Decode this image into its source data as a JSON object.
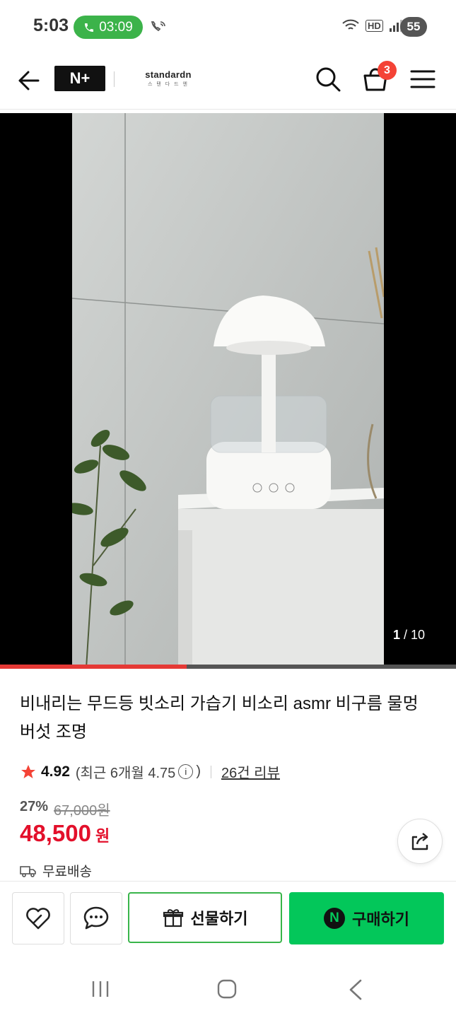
{
  "status_bar": {
    "time": "5:03",
    "call_timer": "03:09",
    "battery": "55",
    "hd_label": "HD"
  },
  "header": {
    "logo_text": "N+",
    "brand_name": "standardn",
    "brand_sub": "스 탠 다 드 엔",
    "cart_count": "3"
  },
  "media": {
    "counter_current": "1",
    "counter_total": "/ 10",
    "progress": 0.41
  },
  "product": {
    "title": "비내리는 무드등 빗소리 가습기 비소리 asmr 비구름 물멍 버섯 조명",
    "rating": "4.92",
    "recent_rating_prefix": "(최근 6개월 4.75",
    "recent_rating_suffix": ")",
    "review_count": "26건 리뷰",
    "discount_rate": "27%",
    "original_price": "67,000원",
    "sale_price": "48,500",
    "currency": "원",
    "shipping": "무료배송"
  },
  "actions": {
    "gift_label": "선물하기",
    "buy_label": "구매하기",
    "n_badge": "N"
  },
  "colors": {
    "accent_green": "#03c75a",
    "price_red": "#e3102b",
    "badge_red": "#f44336",
    "call_green": "#3cb34a"
  }
}
